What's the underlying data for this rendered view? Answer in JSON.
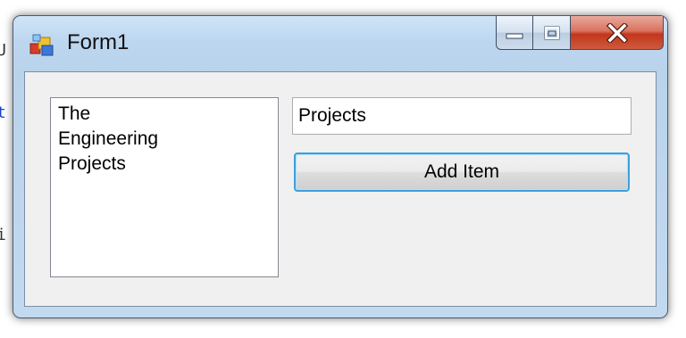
{
  "background_code": {
    "lines": [
      "U",
      "t",
      "i"
    ],
    "line_colors": [
      "#333333",
      "#1a3fd4",
      "#333333"
    ]
  },
  "window": {
    "title": "Form1",
    "icon": "winforms-app-icon",
    "caption_buttons": {
      "minimize": "minimize-icon",
      "maximize": "maximize-icon",
      "close": "close-icon"
    }
  },
  "form": {
    "listbox": {
      "items": [
        "The",
        "Engineering",
        "Projects"
      ]
    },
    "textbox": {
      "value": "Projects"
    },
    "add_button": {
      "label": "Add Item"
    }
  },
  "colors": {
    "title_bar": "#bcd6ef",
    "close_button": "#c2361d",
    "client_area": "#f0f0f0",
    "button_focus_border": "#3c9fde"
  }
}
